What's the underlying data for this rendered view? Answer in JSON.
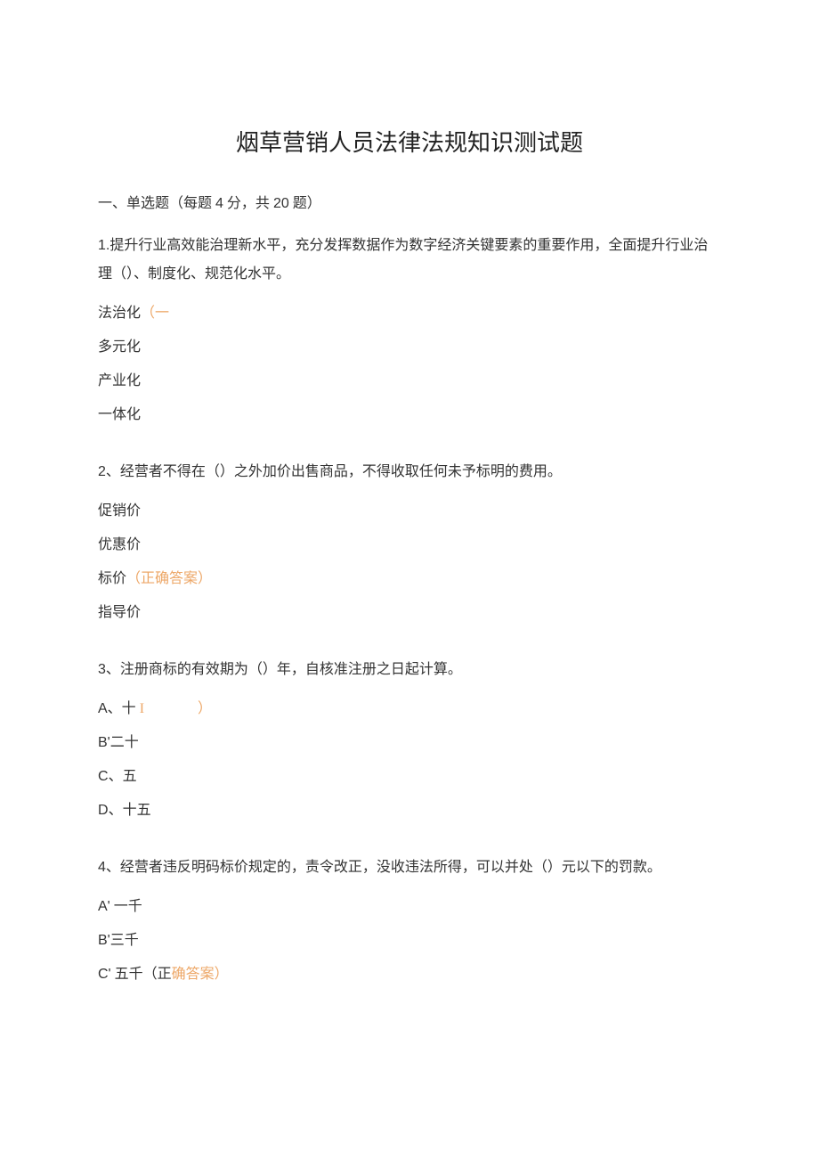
{
  "title": "烟草营销人员法律法规知识测试题",
  "section_heading_prefix": "一、单选题（每题 ",
  "section_heading_points": "4",
  "section_heading_mid": " 分，共 ",
  "section_heading_count": "20",
  "section_heading_suffix": " 题）",
  "q1": {
    "text_prefix": "1.",
    "text": "提升行业高效能治理新水平，充分发挥数据作为数字经济关键要素的重要作用，全面提升行业治理（）、制度化、规范化水平。",
    "opt_a_text": "法治化",
    "opt_a_hint": "（一",
    "opt_b": "多元化",
    "opt_c": "产业化",
    "opt_d": "一体化"
  },
  "q2": {
    "num": "2",
    "text": "、经营者不得在（）之外加价出售商品，不得收取任何未予标明的费用。",
    "opt_a": "促销价",
    "opt_b": "优惠价",
    "opt_c_text": "标价",
    "opt_c_hint": "（正确答案）",
    "opt_d": "指导价"
  },
  "q3": {
    "num": "3",
    "text": "、注册商标的有效期为（）年，自核准注册之日起计算。",
    "opt_a_label": "A",
    "opt_a_text": "、十",
    "opt_a_hint_1": " I",
    "opt_a_hint_2": "）",
    "opt_b_label": "B'",
    "opt_b_text": "二十",
    "opt_c_label": "C",
    "opt_c_text": "、五",
    "opt_d_label": "D",
    "opt_d_text": "、十五"
  },
  "q4": {
    "num": "4",
    "text": "、经营者违反明码标价规定的，责令改正，没收违法所得，可以并处（）元以下的罚款。",
    "opt_a_label": "A'",
    "opt_a_text": " 一千",
    "opt_b_label": "B'",
    "opt_b_text": "三千",
    "opt_c_label": "C'",
    "opt_c_text": " 五千（正",
    "opt_c_hint": "确答案）"
  }
}
